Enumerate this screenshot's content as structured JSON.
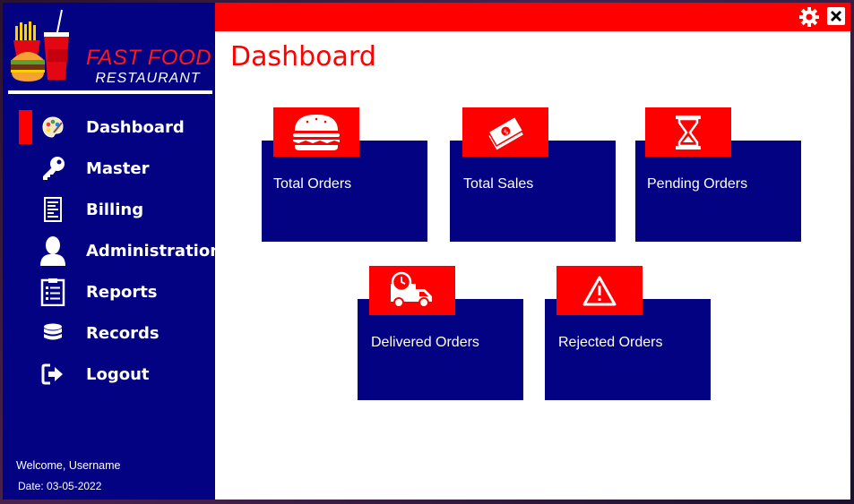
{
  "app": {
    "brand_line1": "FAST FOOD",
    "brand_line2": "RESTAURANT"
  },
  "colors": {
    "sidebar": "#020283",
    "accent": "#ff0000",
    "card": "#020283",
    "background": "#ffffff"
  },
  "sidebar": {
    "items": [
      {
        "label": "Dashboard",
        "icon": "palette-icon",
        "active": true
      },
      {
        "label": "Master",
        "icon": "key-icon"
      },
      {
        "label": "Billing",
        "icon": "receipt-icon"
      },
      {
        "label": "Administration",
        "icon": "user-icon"
      },
      {
        "label": "Reports",
        "icon": "clipboard-list-icon"
      },
      {
        "label": "Records",
        "icon": "database-icon"
      },
      {
        "label": "Logout",
        "icon": "logout-icon"
      }
    ],
    "welcome": "Welcome, Username",
    "date": "Date: 03-05-2022"
  },
  "header": {
    "title": "Dashboard",
    "settings_icon": "gear-icon",
    "close_icon": "close-icon"
  },
  "cards": [
    {
      "label": "Total Orders",
      "icon": "burger-icon"
    },
    {
      "label": "Total Sales",
      "icon": "money-icon"
    },
    {
      "label": "Pending Orders",
      "icon": "hourglass-icon"
    },
    {
      "label": "Delivered Orders",
      "icon": "delivery-truck-icon"
    },
    {
      "label": "Rejected Orders",
      "icon": "warning-icon"
    }
  ]
}
